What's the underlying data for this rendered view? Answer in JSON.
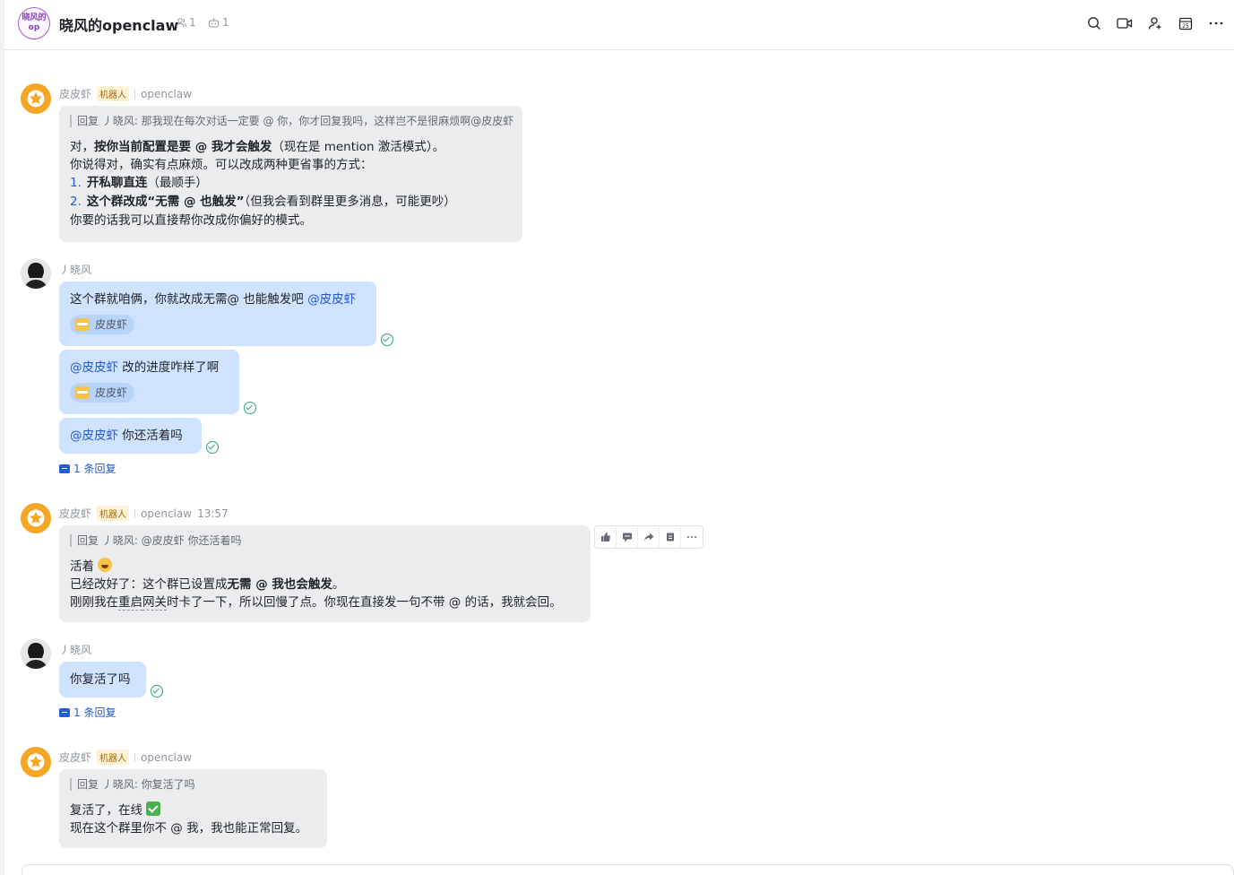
{
  "header": {
    "avatar_text": "晓风的op",
    "title": "晓风的openclaw",
    "member_count": "1",
    "bot_count": "1",
    "icons": [
      "search-icon",
      "video-call-icon",
      "add-member-icon",
      "calendar-icon",
      "more-icon"
    ],
    "calendar_day": "25"
  },
  "bot_name": "皮皮虾",
  "bot_tag": "机器人",
  "bot_app": "openclaw",
  "user_name": "丿晓风",
  "messages": {
    "m1": {
      "quote": "回复 丿晓风: 那我现在每次对话一定要 @ 你，你才回复我吗，这样岂不是很麻烦啊@皮皮虾",
      "line1_pre": "对，",
      "line1_bold": "按你当前配置是要 @ 我才会触发",
      "line1_post": "（现在是 mention 激活模式）。",
      "line2": "你说得对，确实有点麻烦。可以改成两种更省事的方式：",
      "item1_num": "1.",
      "item1_bold": "开私聊直连",
      "item1_post": "（最顺手）",
      "item2_num": "2.",
      "item2_bold": "这个群改成“无需 @ 也触发”",
      "item2_post": "（但我会看到群里更多消息，可能更吵）",
      "line3": "你要的话我可以直接帮你改成你偏好的模式。"
    },
    "m2": {
      "text": "这个群就咱俩，你就改成无需@ 也能触发吧 ",
      "mention": "@皮皮虾",
      "reaction_name": "皮皮虾"
    },
    "m3": {
      "mention": "@皮皮虾",
      "text": " 改的进度咋样了啊",
      "reaction_name": "皮皮虾"
    },
    "m4": {
      "mention": "@皮皮虾",
      "text": " 你还活着吗"
    },
    "replies1": "1 条回复",
    "m5": {
      "time": "13:57",
      "quote": "回复 丿晓风: @皮皮虾 你还活着吗",
      "line1": "活着 ",
      "line2_pre": "已经改好了：这个群已设置成",
      "line2_bold": "无需 @ 我也会触发",
      "line2_post": "。",
      "line3_pre": "刚刚我在",
      "line3_dotted1": "重启",
      "line3_dotted2": "网关",
      "line3_post": "时卡了一下，所以回慢了点。你现在直接发一句不带 @ 的话，我就会回。"
    },
    "m6": {
      "text": "你复活了吗"
    },
    "replies2": "1 条回复",
    "m7": {
      "quote": "回复 丿晓风: 你复活了吗",
      "line1": "复活了，在线 ",
      "line2": "现在这个群里你不 @ 我，我也能正常回复。"
    }
  },
  "toolbar_icons": [
    "thumbs-up-icon",
    "reply-icon",
    "forward-icon",
    "pin-icon",
    "more-icon"
  ]
}
